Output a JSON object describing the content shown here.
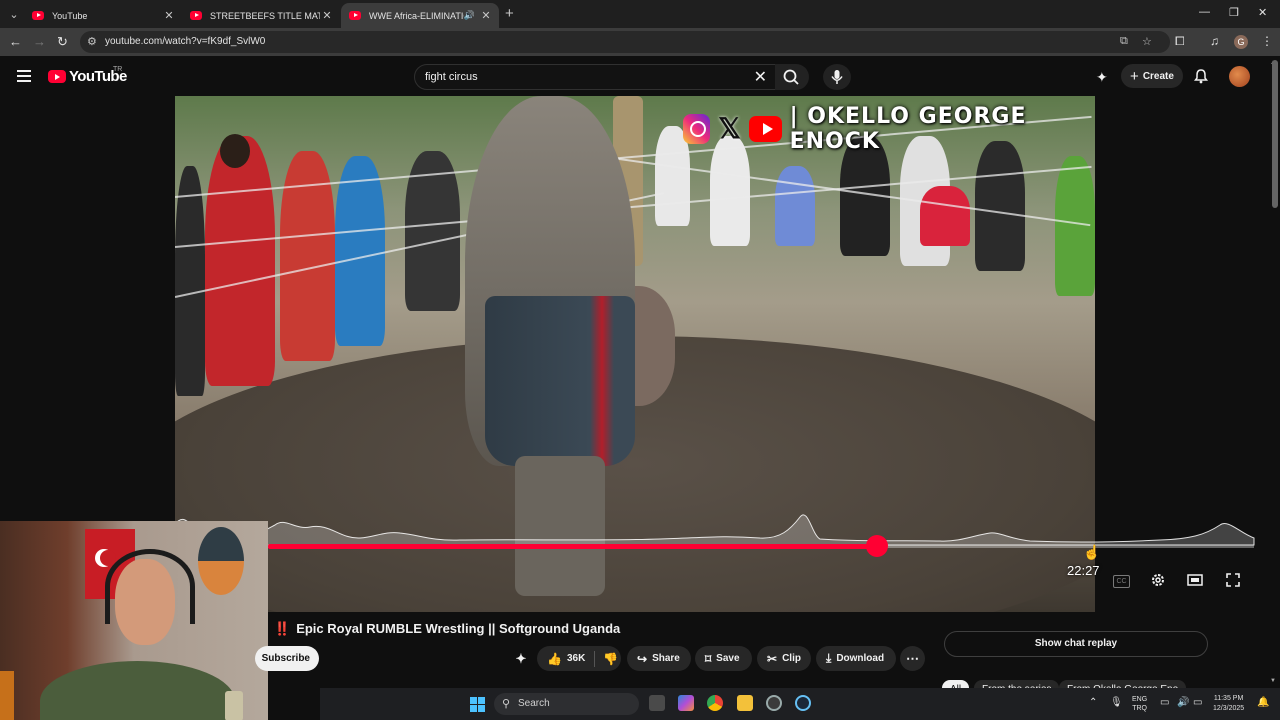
{
  "browser": {
    "tabs": [
      {
        "title": "YouTube",
        "active": false
      },
      {
        "title": "STREETBEEFS TITLE MATCH | BA",
        "active": false
      },
      {
        "title": "WWE Africa-ELIMINATION",
        "active": true
      }
    ],
    "url": "youtube.com/watch?v=fK9df_SvlW0",
    "profile_letter": "G"
  },
  "youtube": {
    "logo_text": "YouTube",
    "country_code": "TR",
    "search_query": "fight circus",
    "create_label": "Create"
  },
  "video": {
    "overlay_branding": "| OKELLO GEORGE ENOCK",
    "hover_time": "22:27",
    "progress_fraction": 0.618,
    "title_prefix": "‼️",
    "title": "Epic Royal RUMBLE Wrestling || Softground Uganda"
  },
  "actions": {
    "subscribe_label": "Subscribe",
    "like_count": "36K",
    "share_label": "Share",
    "save_label": "Save",
    "clip_label": "Clip",
    "download_label": "Download"
  },
  "sidebar": {
    "chat_replay_label": "Show chat replay",
    "chips": [
      "All",
      "From the series",
      "From Okello George Eno"
    ]
  },
  "taskbar": {
    "search_label": "Search",
    "lang_line1": "ENG",
    "lang_line2": "TRQ",
    "time": "11:35 PM",
    "date": "12/3/2025"
  },
  "colors": {
    "accent": "#ff0033",
    "background": "#0f0f0f"
  }
}
